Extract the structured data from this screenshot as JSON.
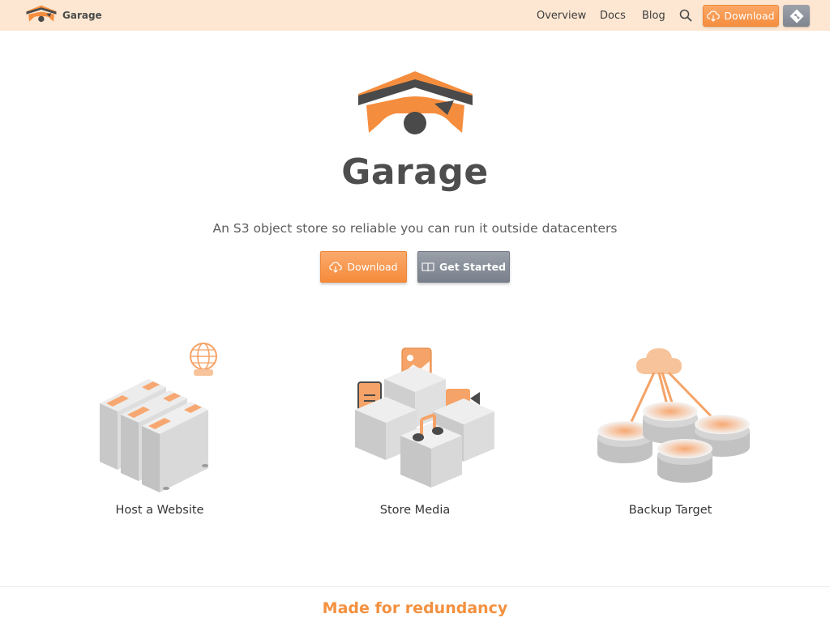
{
  "nav": {
    "brand": "Garage",
    "links": [
      "Overview",
      "Docs",
      "Blog"
    ],
    "download_label": "Download",
    "search_icon": "search-icon",
    "git_icon": "git-icon"
  },
  "hero": {
    "title": "Garage",
    "tagline": "An S3 object store so reliable you can run it outside datacenters",
    "download_label": "Download",
    "get_started_label": "Get Started"
  },
  "features": [
    {
      "label": "Host a Website",
      "icon": "servers-globe-icon"
    },
    {
      "label": "Store Media",
      "icon": "media-cubes-icon"
    },
    {
      "label": "Backup Target",
      "icon": "cloud-disks-icon"
    }
  ],
  "section": {
    "heading": "Made for redundancy"
  },
  "colors": {
    "accent": "#f58d3e",
    "nav_bg": "#fde7d2",
    "secondary_button": "#858b95",
    "heading_gray": "#4e4e4e"
  }
}
